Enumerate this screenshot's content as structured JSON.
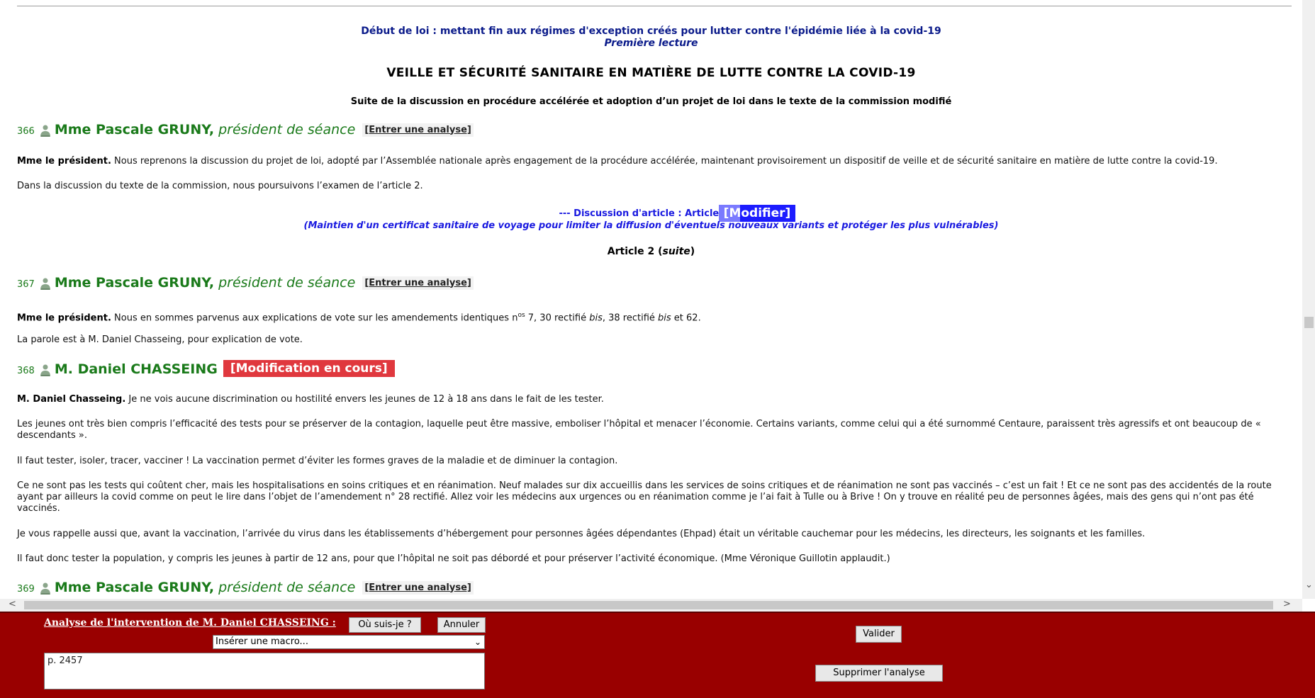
{
  "header": {
    "law_title": "Début de loi : mettant fin aux régimes d'exception créés pour lutter contre l'épidémie liée à la covid-19",
    "reading": "Première lecture",
    "main_title": "VEILLE ET SÉCURITÉ SANITAIRE EN MATIÈRE DE LUTTE CONTRE LA COVID-19",
    "subtitle": "Suite de la discussion en procédure accélérée et adoption d’un projet de loi dans le texte de la commission modifié"
  },
  "interventions": [
    {
      "num": "366",
      "name": "Mme Pascale GRUNY,",
      "role": "président de séance",
      "button": "[Entrer une analyse]"
    },
    {
      "num": "367",
      "name": "Mme Pascale GRUNY,",
      "role": "président de séance",
      "button": "[Entrer une analyse]"
    },
    {
      "num": "368",
      "name": "M. Daniel CHASSEING",
      "role": "",
      "button": "[Modification en cours]"
    },
    {
      "num": "369",
      "name": "Mme Pascale GRUNY,",
      "role": "président de séance",
      "button": "[Entrer une analyse]"
    }
  ],
  "paragraphs": {
    "p366_speaker": "Mme le président.",
    "p366_text": " Nous reprenons la discussion du projet de loi, adopté par l’Assemblée nationale après engagement de la procédure accélérée, maintenant provisoirement un dispositif de veille et de sécurité sanitaire en matière de lutte contre la covid-19.",
    "p366_b": "Dans la discussion du texte de la commission, nous poursuivons l’examen de l’article 2.",
    "article_line": "--- Discussion d'article : Article 2 ---",
    "article_sub": "(Maintien d'un certificat sanitaire de voyage pour limiter la diffusion d'éventuels nouveaux variants et protéger les plus vulnérables)",
    "article_suite_a": "Article 2 (",
    "article_suite_b": "suite",
    "article_suite_c": ")",
    "modifier_button": "[Modifier]",
    "p367_speaker": "Mme le président.",
    "p367_text_a": " Nous en sommes parvenus aux explications de vote sur les amendements identiques n",
    "p367_sup": "os",
    "p367_text_b": " 7, 30 rectifié ",
    "p367_bis1": "bis",
    "p367_text_c": ", 38 rectifié ",
    "p367_bis2": "bis",
    "p367_text_d": " et 62.",
    "p367_b": "La parole est à M. Daniel Chasseing, pour explication de vote.",
    "p368_speaker": "M. Daniel Chasseing.",
    "p368_text": " Je ne vois aucune discrimination ou hostilité envers les jeunes de 12 à 18 ans dans le fait de les tester.",
    "p368_b": "Les jeunes ont très bien compris l’efficacité des tests pour se préserver de la contagion, laquelle peut être massive, emboliser l’hôpital et menacer l’économie. Certains variants, comme celui qui a été surnommé Centaure, paraissent très agressifs et ont beaucoup de « descendants ».",
    "p368_c": "Il faut tester, isoler, tracer, vacciner ! La vaccination permet d’éviter les formes graves de la maladie et de diminuer la contagion.",
    "p368_d": "Ce ne sont pas les tests qui coûtent cher, mais les hospitalisations en soins critiques et en réanimation. Neuf malades sur dix accueillis dans les services de soins critiques et de réanimation ne sont pas vaccinés – c’est un fait ! Et ce ne sont pas des accidentés de la route ayant par ailleurs la covid comme on peut le lire dans l’objet de l’amendement n° 28 rectifié. Allez voir les médecins aux urgences ou en réanimation comme je l’ai fait à Tulle ou à Brive ! On y trouve en réalité peu de personnes âgées, mais des gens qui n’ont pas été vaccinés.",
    "p368_e": "Je vous rappelle aussi que, avant la vaccination, l’arrivée du virus dans les établissements d’hébergement pour personnes âgées dépendantes (Ehpad) était un véritable cauchemar pour les médecins, les directeurs, les soignants et les familles.",
    "p368_f": "Il faut donc tester la population, y compris les jeunes à partir de 12 ans, pour que l’hôpital ne soit pas débordé et pour préserver l’activité économique. (Mme Véronique Guillotin applaudit.)"
  },
  "panel": {
    "title": "Analyse de l'intervention de M. Daniel CHASSEING :",
    "where_button": "Où suis-je ?",
    "cancel_button": "Annuler",
    "validate_button": "Valider",
    "delete_button": "Supprimer l'analyse",
    "macro_select": "Insérer une macro...",
    "analysis_text": "p. 2457"
  },
  "colors": {
    "speaker_green": "#1a7a1a",
    "panel_red": "#990000",
    "modif_red": "#e0383e",
    "modifier_blue": "#1c1cff"
  }
}
